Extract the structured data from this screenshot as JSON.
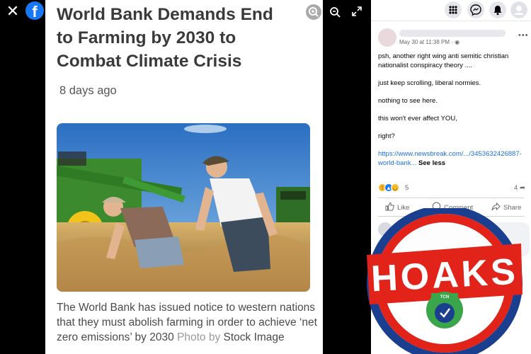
{
  "viewer": {
    "close_icon": "close-icon",
    "logo_letter": "f",
    "article": {
      "title": "World Bank Demands End to Farming by 2030 to Combat Climate Crisis",
      "time": "8 days ago",
      "caption_text": "The World Bank has issued notice to western nations that they must abolish farming in order to achieve ‘net zero emissions’ by 2030",
      "caption_credit": "Photo by",
      "caption_source": "Stock Image"
    },
    "toolbar": {
      "zoom_in_icon": "zoom-in-icon",
      "zoom_out_icon": "zoom-out-icon",
      "expand_icon": "expand-icon"
    }
  },
  "topbar": {
    "icons": [
      "menu-grid-icon",
      "messenger-icon",
      "bell-icon",
      "profile-icon"
    ]
  },
  "post": {
    "date": "May 30 at 11:38 PM ·",
    "paragraphs": [
      "psh, another right wing anti semitic christian nationalist conspiracy theory ....",
      "just keep scrolling, liberal normies.",
      "nothing to see here.",
      "this won't ever affect YOU,",
      "right?"
    ],
    "link": "https://www.newsbreak.com/.../3453632426887-world-bank...",
    "see_less": "See less",
    "reaction_count": "5",
    "share_count": "4",
    "actions": {
      "like": "Like",
      "comment": "Comment",
      "share": "Share"
    }
  },
  "stamp": {
    "word": "HOAKS",
    "seal_label": "TCN"
  },
  "colors": {
    "facebook_blue": "#1877f2",
    "stamp_red": "#e2231a",
    "stamp_blue": "#1b3f8f",
    "seal_green": "#3aa54a"
  }
}
